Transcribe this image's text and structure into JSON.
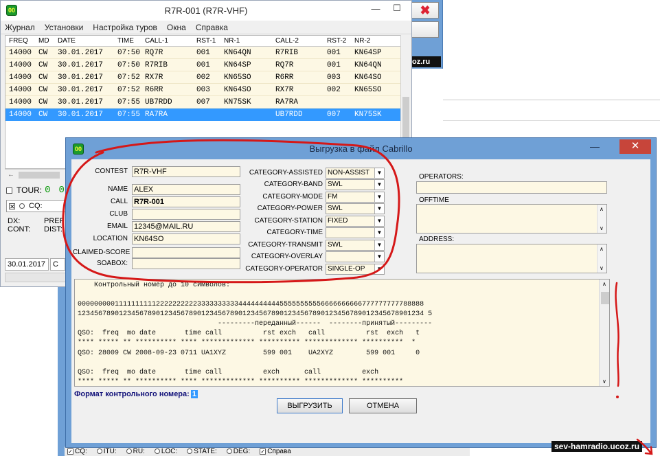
{
  "background": {
    "watermark": "sev-hamradio.ucoz.ru",
    "top_right_text": "oz.ru",
    "close_glyph": "✖",
    "bottom_strip": [
      {
        "type": "check",
        "label": "CQ:",
        "checked": true
      },
      {
        "type": "radio",
        "label": "ITU:"
      },
      {
        "type": "radio",
        "label": "RU:"
      },
      {
        "type": "radio",
        "label": "LOC:"
      },
      {
        "type": "radio",
        "label": "STATE:"
      },
      {
        "type": "radio",
        "label": "DEG:"
      },
      {
        "type": "check",
        "label": "Справа",
        "checked": true
      }
    ]
  },
  "log_window": {
    "title": "R7R-001  (R7R-VHF)",
    "icon_text": "00",
    "minimize_glyph": "—",
    "maximize_glyph": "☐",
    "menu": [
      "Журнал",
      "Установки",
      "Настройка туров",
      "Окна",
      "Справка"
    ],
    "grid": {
      "headers": [
        "FREQ",
        "MD",
        "DATE",
        "TIME",
        "CALL-1",
        "RST-1",
        "NR-1",
        "CALL-2",
        "RST-2",
        "NR-2"
      ],
      "rows": [
        [
          "14000",
          "CW",
          "30.01.2017",
          "07:50",
          "RQ7R",
          "001",
          "KN64QN",
          "R7RIB",
          "001",
          "KN64SP"
        ],
        [
          "14000",
          "CW",
          "30.01.2017",
          "07:50",
          "R7RIB",
          "001",
          " KN64SP",
          "RQ7R",
          "001",
          " KN64QN"
        ],
        [
          "14000",
          "CW",
          "30.01.2017",
          "07:52",
          "RX7R",
          "002",
          "KN65SO",
          "R6RR",
          "003",
          "KN64SO"
        ],
        [
          "14000",
          "CW",
          "30.01.2017",
          "07:52",
          "R6RR",
          "003",
          " KN64SO",
          "RX7R",
          "002",
          " KN65SO"
        ],
        [
          "14000",
          "CW",
          "30.01.2017",
          "07:55",
          "UB7RDD",
          "007",
          "KN75SK",
          "RA7RA",
          "",
          ""
        ],
        [
          "14000",
          "CW",
          "30.01.2017",
          "07:55",
          "RA7RA",
          "",
          "",
          "UB7RDD",
          "007",
          " KN75SK"
        ]
      ],
      "selected_row": 5,
      "hscroll_left": "←"
    },
    "tour_label": "TOUR:",
    "tour_value": "0",
    "tour_value_2": "0",
    "cq_label": "CQ:",
    "cq_close": "✕",
    "dx_label": "DX:",
    "cont_label": "CONT:",
    "pref_label": "PREF",
    "dist_label": "DIST:",
    "date": "30.01.2017",
    "date_suffix": "C"
  },
  "cabrillo_dialog": {
    "title": "Выгрузка в файл Cabrillo",
    "icon_text": "00",
    "minimize_glyph": "—",
    "close_glyph": "✕",
    "fields": {
      "contest": {
        "label": "CONTEST",
        "value": "R7R-VHF"
      },
      "name": {
        "label": "NAME",
        "value": "ALEX"
      },
      "call": {
        "label": "CALL",
        "value": "R7R-001"
      },
      "club": {
        "label": "CLUB",
        "value": ""
      },
      "email": {
        "label": "EMAIL",
        "value": "12345@MAIL.RU"
      },
      "location": {
        "label": "LOCATION",
        "value": "KN64SO"
      },
      "claimed_score": {
        "label": "CLAIMED-SCORE",
        "value": ""
      },
      "soapbox": {
        "label": "SOABOX:",
        "value": ""
      }
    },
    "categories": [
      {
        "label": "CATEGORY-ASSISTED",
        "value": "NON-ASSIST"
      },
      {
        "label": "CATEGORY-BAND",
        "value": "SWL"
      },
      {
        "label": "CATEGORY-MODE",
        "value": "FM"
      },
      {
        "label": "CATEGORY-POWER",
        "value": "SWL"
      },
      {
        "label": "CATEGORY-STATION",
        "value": "FIXED"
      },
      {
        "label": "CATEGORY-TIME",
        "value": ""
      },
      {
        "label": "CATEGORY-TRANSMIT",
        "value": "SWL"
      },
      {
        "label": "CATEGORY-OVERLAY",
        "value": ""
      },
      {
        "label": "CATEGORY-OPERATOR",
        "value": "SINGLE-OP"
      }
    ],
    "dropdown_arrow": "▼",
    "scroll_up": "∧",
    "scroll_down": "∨",
    "operators": {
      "label": "OPERATORS:",
      "value": ""
    },
    "offtime": {
      "label": "OFFTIME",
      "value": ""
    },
    "address": {
      "label": "ADDRESS:",
      "value": ""
    },
    "template_lines": [
      "    Контрольный номер до 10 символов:",
      "",
      "000000000111111111122222222223333333333444444444455555555556666666666777777777788888",
      "123456789012345678901234567890123456789012345678901234567890123456789012345678901234 5",
      "                                  ---------переданный------  --------принятый---------",
      "QSO:  freq  mo date       time call          rst exch   call          rst  exch   t",
      "**** ***** ** ********** **** ************* ********** ************* **********  *",
      "QSO: 28009 CW 2008-09-23 0711 UA1XYZ         599 001    UA2XYZ        599 001     0",
      "",
      "QSO:  freq  mo date       time call          exch      call          exch",
      "**** ***** ** ********** **** ************* ********** ************* **********"
    ],
    "format_label": "Формат контрольного номера:",
    "format_value": "1",
    "export_button": "ВЫГРУЗИТЬ",
    "cancel_button": "ОТМЕНА"
  }
}
